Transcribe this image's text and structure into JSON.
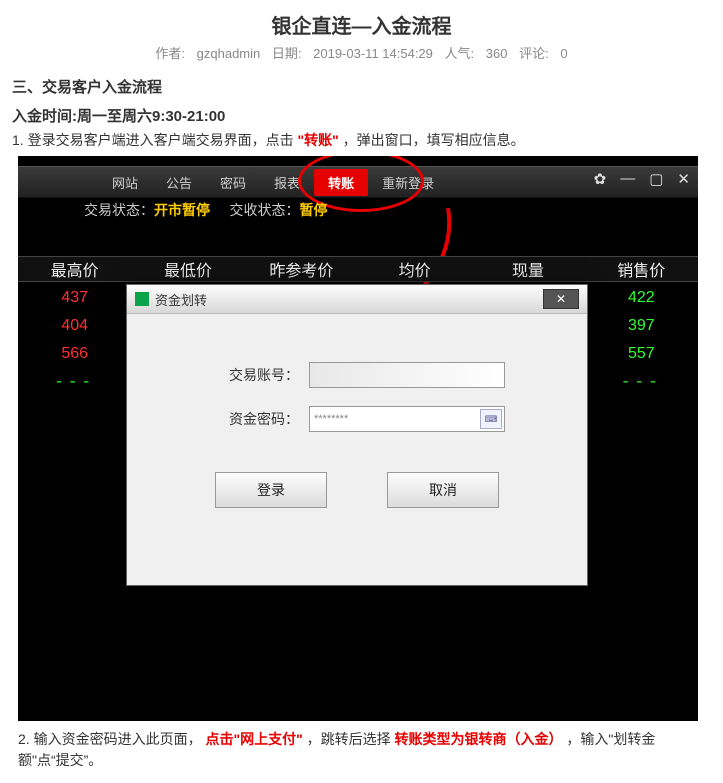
{
  "article": {
    "title": "银企直连—入金流程",
    "meta_author_label": "作者:",
    "meta_author": "gzqhadmin",
    "meta_date_label": "日期:",
    "meta_date": "2019-03-11 14:54:29",
    "meta_pop_label": "人气:",
    "meta_pop": "360",
    "meta_comment_label": "评论:",
    "meta_comment": "0"
  },
  "section": {
    "heading": "三、交易客户入金流程",
    "time_line": "入金时间:周一至周六9:30-21:00",
    "step1_pre": "1. 登录交易客户端进入客户端交易界面，点击",
    "step1_red": "\"转账\"",
    "step1_post": "，弹出窗口，填写相应信息。",
    "step2_pre": "2.  输入资金密码进入此页面，",
    "step2_red1": "点击\"网上支付\"",
    "step2_mid": "，跳转后选择",
    "step2_red2": "转账类型为银转商（入金）",
    "step2_post": "，输入\"划转金额\"点“提交”。"
  },
  "menubar": {
    "items": [
      "网站",
      "公告",
      "密码",
      "报表",
      "转账",
      "重新登录"
    ],
    "active_index": 4,
    "win_gear": "✿",
    "win_min": "—",
    "win_max": "▢",
    "win_close": "✕"
  },
  "status": {
    "l1_label": "交易状态：",
    "l1_value": "开市暂停",
    "l2_label": "交收状态：",
    "l2_value": "暂停"
  },
  "table": {
    "headers": [
      "最高价",
      "最低价",
      "昨参考价",
      "均价",
      "现量",
      "销售价"
    ],
    "rows": [
      {
        "left": "437",
        "right": "422"
      },
      {
        "left": "404",
        "right": "397"
      },
      {
        "left": "566",
        "right": "557"
      }
    ],
    "dash_row": "---"
  },
  "dialog": {
    "title": "资金划转",
    "close_sym": "✕",
    "acct_label": "交易账号：",
    "pwd_label": "资金密码：",
    "pwd_mask": "********",
    "kbd": "⌨",
    "btn_login": "登录",
    "btn_cancel": "取消"
  }
}
